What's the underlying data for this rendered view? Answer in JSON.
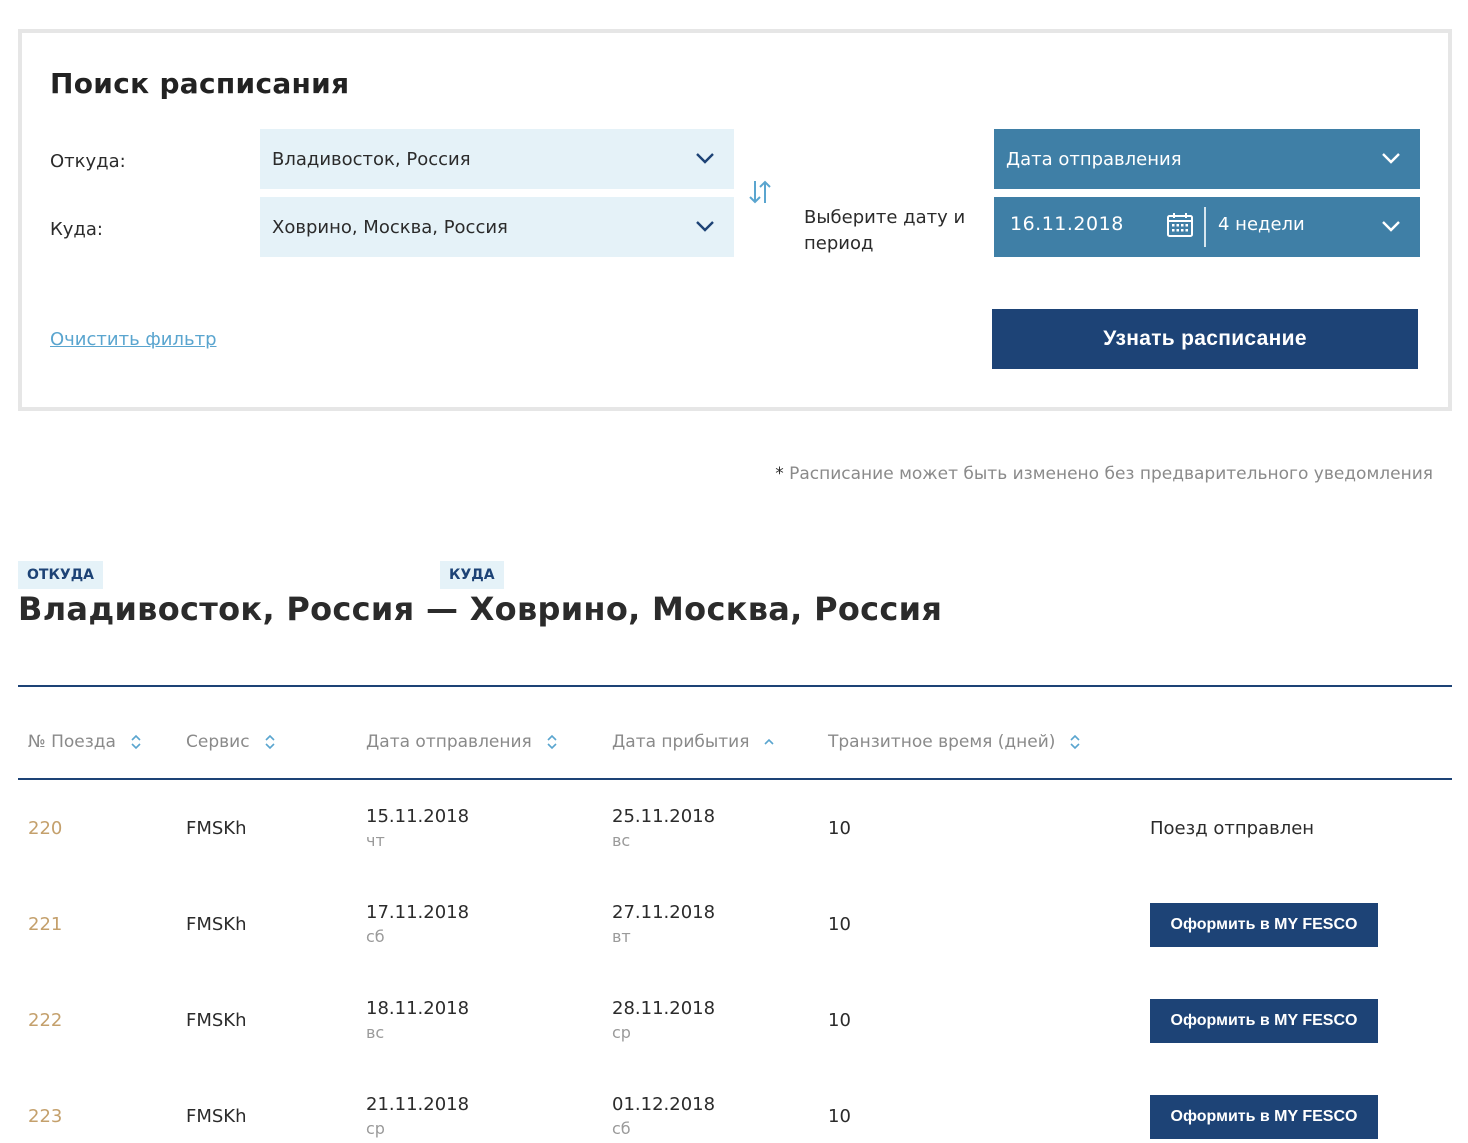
{
  "search": {
    "title": "Поиск расписания",
    "from_label": "Откуда:",
    "from_value": "Владивосток, Россия",
    "to_label": "Куда:",
    "to_value": "Ховрино, Москва, Россия",
    "date_hint": "Выберите дату и период",
    "date_type_value": "Дата отправления",
    "date_value": "16.11.2018",
    "period_value": "4 недели",
    "clear_label": "Очистить фильтр",
    "submit_label": "Узнать расписание"
  },
  "notice": {
    "star": "*",
    "text": "Расписание может быть изменено без предварительного уведомления"
  },
  "route": {
    "from_tag": "ОТКУДА",
    "to_tag": "КУДА",
    "from_city": "Владивосток, Россия",
    "separator": "—",
    "to_city": "Ховрино, Москва, Россия"
  },
  "table": {
    "headers": [
      "№ Поезда",
      "Сервис",
      "Дата отправления",
      "Дата прибытия",
      "Транзитное время (дней)"
    ],
    "rows": [
      {
        "train": "220",
        "service": "FMSKh",
        "dep_date": "15.11.2018",
        "dep_dow": "чт",
        "arr_date": "25.11.2018",
        "arr_dow": "вс",
        "transit": "10",
        "status": "Поезд отправлен"
      },
      {
        "train": "221",
        "service": "FMSKh",
        "dep_date": "17.11.2018",
        "dep_dow": "сб",
        "arr_date": "27.11.2018",
        "arr_dow": "вт",
        "transit": "10",
        "action": "Оформить в MY FESCO"
      },
      {
        "train": "222",
        "service": "FMSKh",
        "dep_date": "18.11.2018",
        "dep_dow": "вс",
        "arr_date": "28.11.2018",
        "arr_dow": "ср",
        "transit": "10",
        "action": "Оформить в MY FESCO"
      },
      {
        "train": "223",
        "service": "FMSKh",
        "dep_date": "21.11.2018",
        "dep_dow": "ср",
        "arr_date": "01.12.2018",
        "arr_dow": "сб",
        "transit": "10",
        "action": "Оформить в MY FESCO"
      }
    ]
  },
  "colors": {
    "primary": "#1d4376",
    "accent": "#3f7fa6",
    "light": "#e5f2f8",
    "link": "#5aa5cf",
    "train_number": "#c4a06c"
  },
  "icons": {
    "dropdown": "chevron-down-icon",
    "swap": "swap-arrows-icon",
    "calendar": "calendar-icon",
    "sort": "sort-icon",
    "sort_asc": "sort-ascending-icon"
  }
}
